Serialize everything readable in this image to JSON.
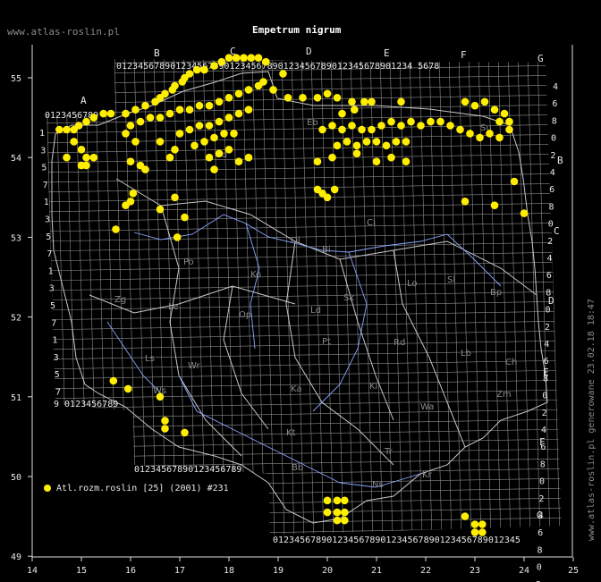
{
  "header": {
    "site": "www.atlas-roslin.pl",
    "title": "Empetrum nigrum",
    "generated": "www.atlas-roslin.pl generowane 23.02.18 18:47"
  },
  "legend": {
    "label": "Atl.rozm.roslin [25] (2001) #231",
    "color": "#ffee00"
  },
  "axes": {
    "lon_ticks": [
      "14",
      "15",
      "16",
      "17",
      "18",
      "19",
      "20",
      "21",
      "22",
      "23",
      "24",
      "25"
    ],
    "lat_ticks": [
      "55",
      "54",
      "53",
      "52",
      "51",
      "50",
      "49"
    ]
  },
  "grid_letters": {
    "top": [
      "A",
      "B",
      "C",
      "D",
      "E",
      "F",
      "G"
    ],
    "right": [
      "B",
      "C",
      "D",
      "E",
      "F",
      "G"
    ]
  },
  "grid_digits": {
    "top_row": "0123456789012345678901234567890123456789012345678901234 5678",
    "row_A": "0123456789",
    "bottom_left": "9 0123456789",
    "bottom_mid": "01234567890123456789",
    "bottom_row": "0123456789012345678901234567890123456789012345"
  },
  "regions": [
    "Eb",
    "Su",
    "Ci",
    "Ko",
    "Ol",
    "Bi",
    "Zg",
    "Le",
    "Po",
    "Sk",
    "Lo",
    "Ld",
    "Pt",
    "Rd",
    "Lb",
    "Wr",
    "Op",
    "Ki",
    "Kt",
    "Tr",
    "Bb",
    "Ns",
    "Kr",
    "Ch",
    "Zm",
    "Sl",
    "Ka",
    "Bp",
    "Wa",
    "Gd",
    "Ls",
    "Ws"
  ],
  "chart_data": {
    "type": "scatter",
    "series": [
      {
        "name": "Atl.rozm.roslin [25] (2001) #231",
        "points": [
          [
            14.55,
            54.35
          ],
          [
            14.7,
            54.35
          ],
          [
            14.85,
            54.35
          ],
          [
            14.95,
            54.4
          ],
          [
            15.1,
            54.45
          ],
          [
            15.25,
            54.5
          ],
          [
            15.45,
            54.55
          ],
          [
            15.6,
            54.55
          ],
          [
            14.85,
            54.2
          ],
          [
            15.0,
            54.1
          ],
          [
            14.7,
            54.0
          ],
          [
            15.1,
            54.0
          ],
          [
            15.25,
            54.0
          ],
          [
            15.0,
            53.9
          ],
          [
            15.1,
            53.9
          ],
          [
            15.9,
            54.55
          ],
          [
            16.1,
            54.6
          ],
          [
            16.3,
            54.65
          ],
          [
            16.5,
            54.7
          ],
          [
            16.6,
            54.75
          ],
          [
            16.7,
            54.8
          ],
          [
            16.85,
            54.85
          ],
          [
            16.9,
            54.9
          ],
          [
            17.05,
            54.95
          ],
          [
            17.1,
            55.0
          ],
          [
            17.2,
            55.05
          ],
          [
            17.35,
            55.1
          ],
          [
            17.5,
            55.1
          ],
          [
            17.7,
            55.15
          ],
          [
            17.85,
            55.2
          ],
          [
            18.0,
            55.25
          ],
          [
            18.15,
            55.25
          ],
          [
            18.3,
            55.25
          ],
          [
            18.45,
            55.25
          ],
          [
            18.6,
            55.25
          ],
          [
            18.75,
            55.2
          ],
          [
            16.0,
            54.4
          ],
          [
            16.2,
            54.45
          ],
          [
            16.4,
            54.5
          ],
          [
            16.6,
            54.5
          ],
          [
            16.8,
            54.55
          ],
          [
            17.0,
            54.6
          ],
          [
            17.2,
            54.6
          ],
          [
            17.4,
            54.65
          ],
          [
            17.6,
            54.65
          ],
          [
            17.8,
            54.7
          ],
          [
            18.0,
            54.75
          ],
          [
            18.2,
            54.8
          ],
          [
            18.4,
            54.85
          ],
          [
            18.6,
            54.9
          ],
          [
            18.7,
            54.95
          ],
          [
            17.0,
            54.3
          ],
          [
            17.2,
            54.35
          ],
          [
            17.4,
            54.4
          ],
          [
            17.6,
            54.4
          ],
          [
            17.8,
            54.45
          ],
          [
            18.0,
            54.5
          ],
          [
            18.2,
            54.55
          ],
          [
            18.4,
            54.6
          ],
          [
            17.3,
            54.15
          ],
          [
            17.5,
            54.2
          ],
          [
            17.7,
            54.25
          ],
          [
            17.9,
            54.3
          ],
          [
            18.1,
            54.3
          ],
          [
            17.6,
            54.0
          ],
          [
            17.8,
            54.05
          ],
          [
            18.0,
            54.1
          ],
          [
            17.7,
            53.85
          ],
          [
            18.2,
            53.95
          ],
          [
            18.4,
            54.0
          ],
          [
            16.2,
            53.9
          ],
          [
            16.0,
            53.95
          ],
          [
            16.3,
            53.85
          ],
          [
            16.8,
            54.0
          ],
          [
            16.9,
            54.1
          ],
          [
            16.6,
            54.2
          ],
          [
            16.1,
            54.2
          ],
          [
            15.9,
            54.3
          ],
          [
            19.1,
            55.05
          ],
          [
            18.9,
            54.85
          ],
          [
            19.2,
            54.75
          ],
          [
            19.5,
            54.75
          ],
          [
            19.8,
            54.75
          ],
          [
            20.0,
            54.8
          ],
          [
            20.2,
            54.75
          ],
          [
            20.5,
            54.7
          ],
          [
            20.75,
            54.7
          ],
          [
            20.9,
            54.7
          ],
          [
            21.5,
            54.7
          ],
          [
            20.3,
            54.55
          ],
          [
            20.55,
            54.6
          ],
          [
            19.9,
            54.35
          ],
          [
            20.1,
            54.4
          ],
          [
            20.3,
            54.35
          ],
          [
            20.5,
            54.4
          ],
          [
            20.7,
            54.35
          ],
          [
            20.9,
            54.35
          ],
          [
            21.1,
            54.4
          ],
          [
            21.3,
            54.45
          ],
          [
            21.5,
            54.4
          ],
          [
            21.7,
            54.45
          ],
          [
            20.2,
            54.15
          ],
          [
            20.4,
            54.2
          ],
          [
            20.6,
            54.15
          ],
          [
            20.8,
            54.2
          ],
          [
            21.0,
            54.2
          ],
          [
            21.2,
            54.15
          ],
          [
            21.4,
            54.2
          ],
          [
            21.6,
            54.2
          ],
          [
            19.8,
            53.95
          ],
          [
            20.1,
            54.0
          ],
          [
            20.6,
            54.05
          ],
          [
            21.0,
            53.95
          ],
          [
            21.3,
            54.0
          ],
          [
            21.6,
            53.95
          ],
          [
            19.8,
            53.6
          ],
          [
            19.9,
            53.55
          ],
          [
            20.0,
            53.5
          ],
          [
            20.15,
            53.6
          ],
          [
            21.9,
            54.4
          ],
          [
            22.1,
            54.45
          ],
          [
            22.3,
            54.45
          ],
          [
            22.5,
            54.4
          ],
          [
            22.7,
            54.35
          ],
          [
            22.9,
            54.3
          ],
          [
            23.1,
            54.25
          ],
          [
            23.3,
            54.3
          ],
          [
            23.5,
            54.25
          ],
          [
            23.7,
            54.35
          ],
          [
            22.8,
            54.7
          ],
          [
            23.0,
            54.65
          ],
          [
            23.2,
            54.7
          ],
          [
            23.4,
            54.6
          ],
          [
            23.6,
            54.55
          ],
          [
            23.5,
            54.45
          ],
          [
            23.7,
            54.45
          ],
          [
            23.8,
            53.7
          ],
          [
            24.0,
            53.3
          ],
          [
            22.8,
            53.45
          ],
          [
            23.4,
            53.4
          ],
          [
            15.7,
            53.1
          ],
          [
            15.9,
            53.4
          ],
          [
            16.0,
            53.45
          ],
          [
            16.05,
            53.55
          ],
          [
            16.6,
            53.35
          ],
          [
            16.9,
            53.5
          ],
          [
            17.1,
            53.25
          ],
          [
            16.95,
            53.0
          ],
          [
            15.65,
            51.2
          ],
          [
            15.95,
            51.1
          ],
          [
            16.6,
            51.0
          ],
          [
            16.7,
            50.7
          ],
          [
            16.7,
            50.6
          ],
          [
            17.1,
            50.55
          ],
          [
            20.0,
            49.7
          ],
          [
            20.2,
            49.7
          ],
          [
            20.35,
            49.7
          ],
          [
            20.0,
            49.55
          ],
          [
            20.2,
            49.55
          ],
          [
            20.35,
            49.55
          ],
          [
            20.2,
            49.45
          ],
          [
            20.35,
            49.45
          ],
          [
            22.8,
            49.5
          ],
          [
            23.0,
            49.4
          ],
          [
            23.15,
            49.4
          ],
          [
            23.0,
            49.3
          ],
          [
            23.15,
            49.3
          ]
        ]
      }
    ]
  }
}
